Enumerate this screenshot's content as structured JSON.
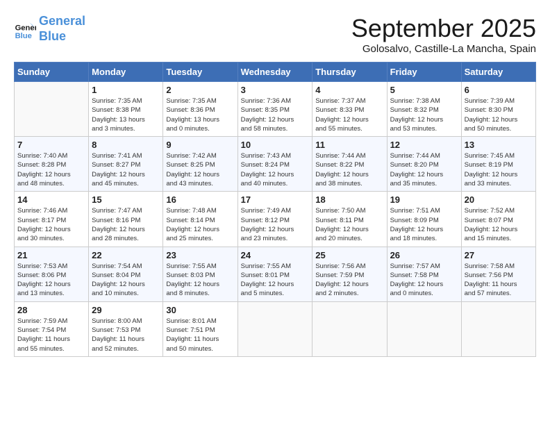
{
  "header": {
    "logo_line1": "General",
    "logo_line2": "Blue",
    "month_title": "September 2025",
    "location": "Golosalvo, Castille-La Mancha, Spain"
  },
  "weekdays": [
    "Sunday",
    "Monday",
    "Tuesday",
    "Wednesday",
    "Thursday",
    "Friday",
    "Saturday"
  ],
  "weeks": [
    [
      {
        "day": "",
        "info": ""
      },
      {
        "day": "1",
        "info": "Sunrise: 7:35 AM\nSunset: 8:38 PM\nDaylight: 13 hours\nand 3 minutes."
      },
      {
        "day": "2",
        "info": "Sunrise: 7:35 AM\nSunset: 8:36 PM\nDaylight: 13 hours\nand 0 minutes."
      },
      {
        "day": "3",
        "info": "Sunrise: 7:36 AM\nSunset: 8:35 PM\nDaylight: 12 hours\nand 58 minutes."
      },
      {
        "day": "4",
        "info": "Sunrise: 7:37 AM\nSunset: 8:33 PM\nDaylight: 12 hours\nand 55 minutes."
      },
      {
        "day": "5",
        "info": "Sunrise: 7:38 AM\nSunset: 8:32 PM\nDaylight: 12 hours\nand 53 minutes."
      },
      {
        "day": "6",
        "info": "Sunrise: 7:39 AM\nSunset: 8:30 PM\nDaylight: 12 hours\nand 50 minutes."
      }
    ],
    [
      {
        "day": "7",
        "info": "Sunrise: 7:40 AM\nSunset: 8:28 PM\nDaylight: 12 hours\nand 48 minutes."
      },
      {
        "day": "8",
        "info": "Sunrise: 7:41 AM\nSunset: 8:27 PM\nDaylight: 12 hours\nand 45 minutes."
      },
      {
        "day": "9",
        "info": "Sunrise: 7:42 AM\nSunset: 8:25 PM\nDaylight: 12 hours\nand 43 minutes."
      },
      {
        "day": "10",
        "info": "Sunrise: 7:43 AM\nSunset: 8:24 PM\nDaylight: 12 hours\nand 40 minutes."
      },
      {
        "day": "11",
        "info": "Sunrise: 7:44 AM\nSunset: 8:22 PM\nDaylight: 12 hours\nand 38 minutes."
      },
      {
        "day": "12",
        "info": "Sunrise: 7:44 AM\nSunset: 8:20 PM\nDaylight: 12 hours\nand 35 minutes."
      },
      {
        "day": "13",
        "info": "Sunrise: 7:45 AM\nSunset: 8:19 PM\nDaylight: 12 hours\nand 33 minutes."
      }
    ],
    [
      {
        "day": "14",
        "info": "Sunrise: 7:46 AM\nSunset: 8:17 PM\nDaylight: 12 hours\nand 30 minutes."
      },
      {
        "day": "15",
        "info": "Sunrise: 7:47 AM\nSunset: 8:16 PM\nDaylight: 12 hours\nand 28 minutes."
      },
      {
        "day": "16",
        "info": "Sunrise: 7:48 AM\nSunset: 8:14 PM\nDaylight: 12 hours\nand 25 minutes."
      },
      {
        "day": "17",
        "info": "Sunrise: 7:49 AM\nSunset: 8:12 PM\nDaylight: 12 hours\nand 23 minutes."
      },
      {
        "day": "18",
        "info": "Sunrise: 7:50 AM\nSunset: 8:11 PM\nDaylight: 12 hours\nand 20 minutes."
      },
      {
        "day": "19",
        "info": "Sunrise: 7:51 AM\nSunset: 8:09 PM\nDaylight: 12 hours\nand 18 minutes."
      },
      {
        "day": "20",
        "info": "Sunrise: 7:52 AM\nSunset: 8:07 PM\nDaylight: 12 hours\nand 15 minutes."
      }
    ],
    [
      {
        "day": "21",
        "info": "Sunrise: 7:53 AM\nSunset: 8:06 PM\nDaylight: 12 hours\nand 13 minutes."
      },
      {
        "day": "22",
        "info": "Sunrise: 7:54 AM\nSunset: 8:04 PM\nDaylight: 12 hours\nand 10 minutes."
      },
      {
        "day": "23",
        "info": "Sunrise: 7:55 AM\nSunset: 8:03 PM\nDaylight: 12 hours\nand 8 minutes."
      },
      {
        "day": "24",
        "info": "Sunrise: 7:55 AM\nSunset: 8:01 PM\nDaylight: 12 hours\nand 5 minutes."
      },
      {
        "day": "25",
        "info": "Sunrise: 7:56 AM\nSunset: 7:59 PM\nDaylight: 12 hours\nand 2 minutes."
      },
      {
        "day": "26",
        "info": "Sunrise: 7:57 AM\nSunset: 7:58 PM\nDaylight: 12 hours\nand 0 minutes."
      },
      {
        "day": "27",
        "info": "Sunrise: 7:58 AM\nSunset: 7:56 PM\nDaylight: 11 hours\nand 57 minutes."
      }
    ],
    [
      {
        "day": "28",
        "info": "Sunrise: 7:59 AM\nSunset: 7:54 PM\nDaylight: 11 hours\nand 55 minutes."
      },
      {
        "day": "29",
        "info": "Sunrise: 8:00 AM\nSunset: 7:53 PM\nDaylight: 11 hours\nand 52 minutes."
      },
      {
        "day": "30",
        "info": "Sunrise: 8:01 AM\nSunset: 7:51 PM\nDaylight: 11 hours\nand 50 minutes."
      },
      {
        "day": "",
        "info": ""
      },
      {
        "day": "",
        "info": ""
      },
      {
        "day": "",
        "info": ""
      },
      {
        "day": "",
        "info": ""
      }
    ]
  ]
}
